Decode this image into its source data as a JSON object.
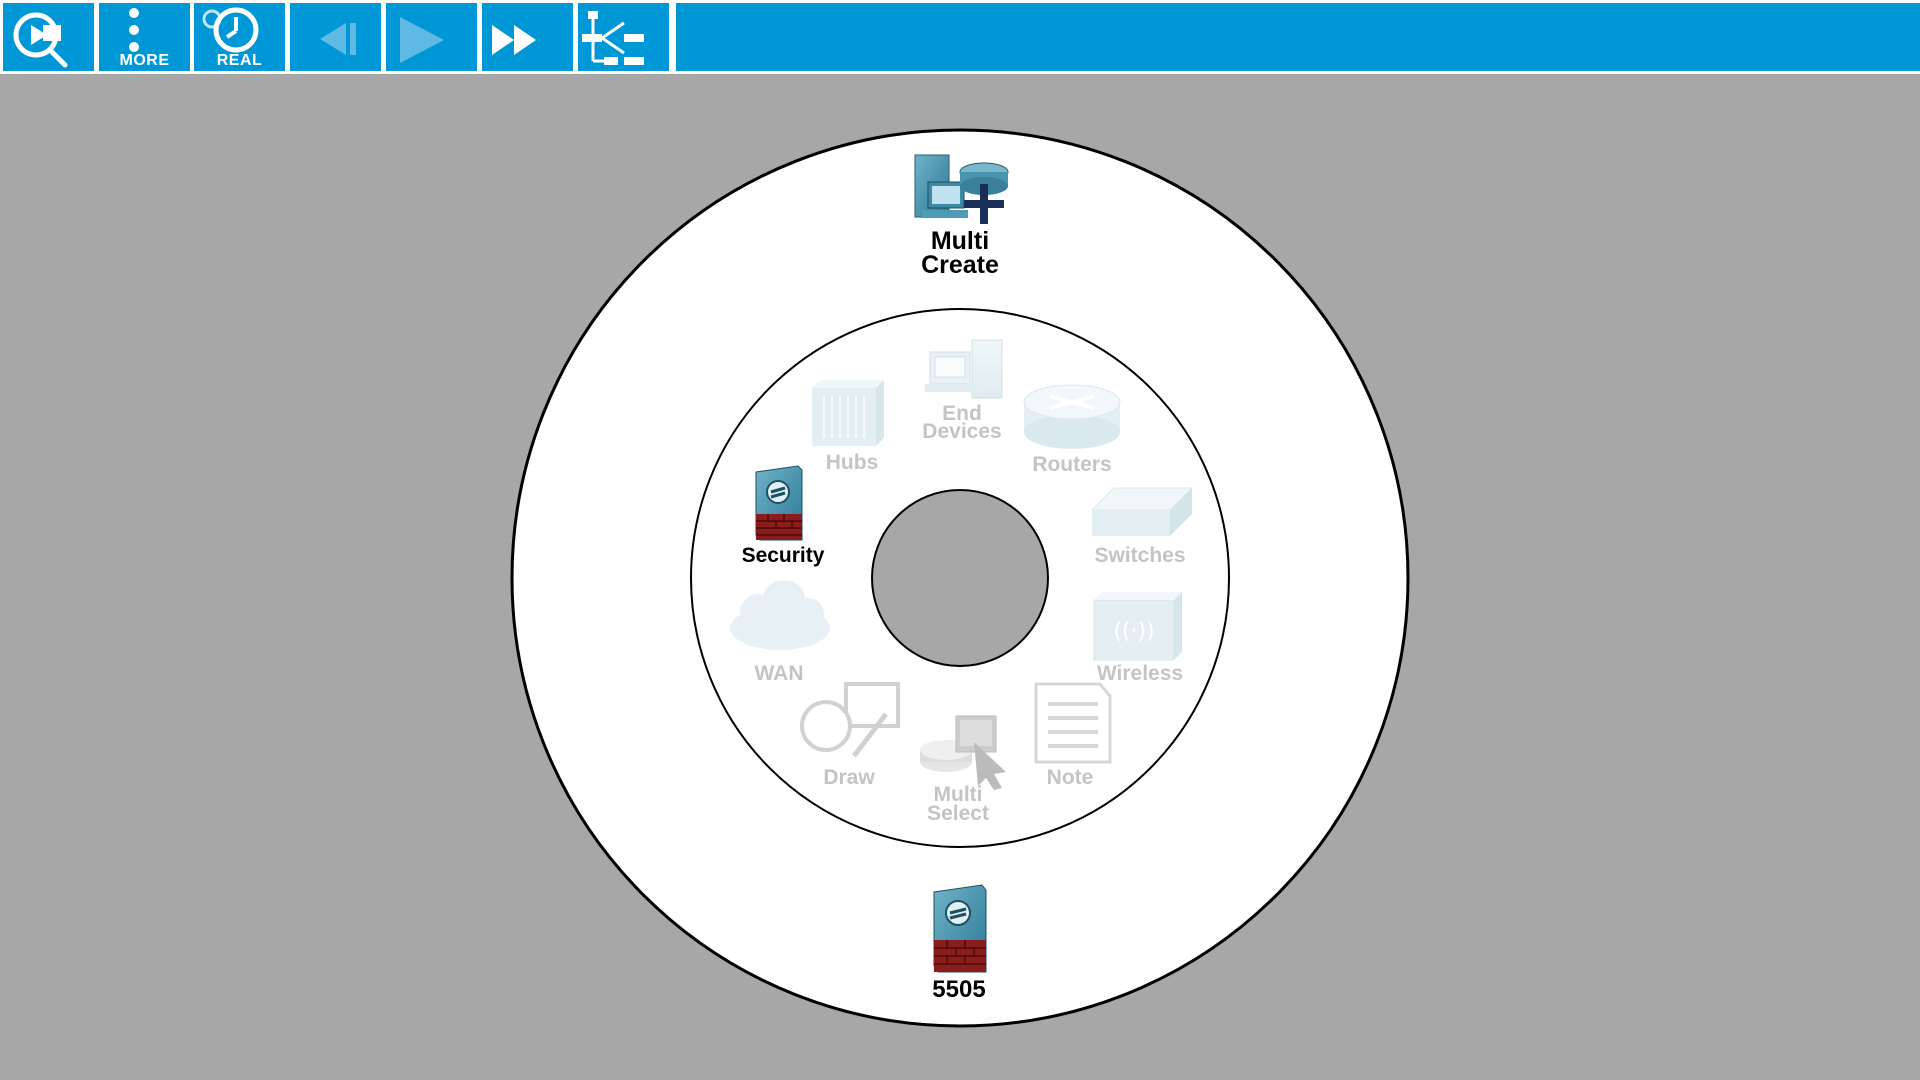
{
  "toolbar": {
    "buttons": [
      {
        "id": "inspect",
        "label": "",
        "icon": "inspect-magnifier-icon"
      },
      {
        "id": "more",
        "label": "MORE",
        "icon": "vertical-dots-icon"
      },
      {
        "id": "real",
        "label": "REAL",
        "icon": "clock-icon"
      },
      {
        "id": "back",
        "label": "",
        "icon": "step-back-icon"
      },
      {
        "id": "play",
        "label": "",
        "icon": "play-icon"
      },
      {
        "id": "fast-forward",
        "label": "",
        "icon": "fast-forward-icon"
      },
      {
        "id": "topology",
        "label": "",
        "icon": "topology-tree-icon"
      }
    ]
  },
  "wheel": {
    "top_item": {
      "line1": "Multi",
      "line2": "Create",
      "icon": "multi-create-icon"
    },
    "bottom_item": {
      "label": "5505",
      "icon": "asa-firewall-icon"
    },
    "categories": {
      "end_devices": {
        "line1": "End",
        "line2": "Devices",
        "active": false
      },
      "routers": {
        "label": "Routers",
        "active": false
      },
      "switches": {
        "label": "Switches",
        "active": false
      },
      "wireless": {
        "label": "Wireless",
        "active": false
      },
      "note": {
        "label": "Note",
        "active": false
      },
      "multi_select": {
        "line1": "Multi",
        "line2": "Select",
        "active": false
      },
      "draw": {
        "label": "Draw",
        "active": false
      },
      "wan": {
        "label": "WAN",
        "active": false
      },
      "security": {
        "label": "Security",
        "active": true
      },
      "hubs": {
        "label": "Hubs",
        "active": false
      }
    }
  },
  "colors": {
    "toolbar": "#0097d7",
    "background": "#a7a7a7",
    "inactive_label": "#c4c4c4",
    "active_label": "#000000"
  }
}
